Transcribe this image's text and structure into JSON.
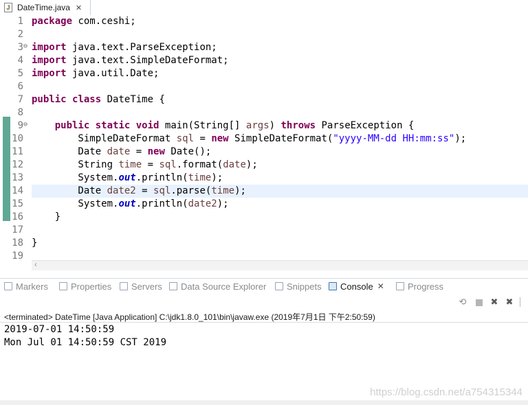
{
  "editor_tab": {
    "label": "DateTime.java",
    "file_icon_glyph": "J"
  },
  "code": [
    {
      "n": "1",
      "tokens": [
        {
          "t": "kw",
          "v": "package"
        },
        {
          "t": "plain",
          "v": " com.ceshi;"
        }
      ]
    },
    {
      "n": "2",
      "tokens": []
    },
    {
      "n": "3",
      "fold": true,
      "tokens": [
        {
          "t": "kw",
          "v": "import"
        },
        {
          "t": "plain",
          "v": " java.text.ParseException;"
        }
      ]
    },
    {
      "n": "4",
      "tokens": [
        {
          "t": "kw",
          "v": "import"
        },
        {
          "t": "plain",
          "v": " java.text.SimpleDateFormat;"
        }
      ]
    },
    {
      "n": "5",
      "tokens": [
        {
          "t": "kw",
          "v": "import"
        },
        {
          "t": "plain",
          "v": " java.util.Date;"
        }
      ]
    },
    {
      "n": "6",
      "tokens": []
    },
    {
      "n": "7",
      "tokens": [
        {
          "t": "kw",
          "v": "public"
        },
        {
          "t": "plain",
          "v": " "
        },
        {
          "t": "kw",
          "v": "class"
        },
        {
          "t": "plain",
          "v": " DateTime {"
        }
      ]
    },
    {
      "n": "8",
      "tokens": []
    },
    {
      "n": "9",
      "fold": true,
      "tokens": [
        {
          "t": "plain",
          "v": "    "
        },
        {
          "t": "kw",
          "v": "public"
        },
        {
          "t": "plain",
          "v": " "
        },
        {
          "t": "kw",
          "v": "static"
        },
        {
          "t": "plain",
          "v": " "
        },
        {
          "t": "kw",
          "v": "void"
        },
        {
          "t": "plain",
          "v": " main(String[] "
        },
        {
          "t": "local",
          "v": "args"
        },
        {
          "t": "plain",
          "v": ") "
        },
        {
          "t": "kw",
          "v": "throws"
        },
        {
          "t": "plain",
          "v": " ParseException {"
        }
      ]
    },
    {
      "n": "10",
      "tokens": [
        {
          "t": "plain",
          "v": "        SimpleDateFormat "
        },
        {
          "t": "local",
          "v": "sql"
        },
        {
          "t": "plain",
          "v": " = "
        },
        {
          "t": "kw",
          "v": "new"
        },
        {
          "t": "plain",
          "v": " SimpleDateFormat("
        },
        {
          "t": "str",
          "v": "\"yyyy-MM-dd HH:mm:ss\""
        },
        {
          "t": "plain",
          "v": ");"
        }
      ]
    },
    {
      "n": "11",
      "tokens": [
        {
          "t": "plain",
          "v": "        Date "
        },
        {
          "t": "local",
          "v": "date"
        },
        {
          "t": "plain",
          "v": " = "
        },
        {
          "t": "kw",
          "v": "new"
        },
        {
          "t": "plain",
          "v": " Date();"
        }
      ]
    },
    {
      "n": "12",
      "tokens": [
        {
          "t": "plain",
          "v": "        String "
        },
        {
          "t": "local",
          "v": "time"
        },
        {
          "t": "plain",
          "v": " = "
        },
        {
          "t": "local",
          "v": "sql"
        },
        {
          "t": "plain",
          "v": ".format("
        },
        {
          "t": "local",
          "v": "date"
        },
        {
          "t": "plain",
          "v": ");"
        }
      ]
    },
    {
      "n": "13",
      "tokens": [
        {
          "t": "plain",
          "v": "        System."
        },
        {
          "t": "field",
          "v": "out"
        },
        {
          "t": "plain",
          "v": ".println("
        },
        {
          "t": "local",
          "v": "time"
        },
        {
          "t": "plain",
          "v": ");"
        }
      ]
    },
    {
      "n": "14",
      "highlight": true,
      "tokens": [
        {
          "t": "plain",
          "v": "        Date "
        },
        {
          "t": "local",
          "v": "date2"
        },
        {
          "t": "plain",
          "v": " = "
        },
        {
          "t": "local",
          "v": "sql"
        },
        {
          "t": "plain",
          "v": ".parse("
        },
        {
          "t": "local",
          "v": "time"
        },
        {
          "t": "plain",
          "v": ");"
        }
      ]
    },
    {
      "n": "15",
      "tokens": [
        {
          "t": "plain",
          "v": "        System."
        },
        {
          "t": "field",
          "v": "out"
        },
        {
          "t": "plain",
          "v": ".println("
        },
        {
          "t": "local",
          "v": "date2"
        },
        {
          "t": "plain",
          "v": ");"
        }
      ]
    },
    {
      "n": "16",
      "tokens": [
        {
          "t": "plain",
          "v": "    }"
        }
      ]
    },
    {
      "n": "17",
      "tokens": []
    },
    {
      "n": "18",
      "tokens": [
        {
          "t": "plain",
          "v": "}"
        }
      ]
    },
    {
      "n": "19",
      "tokens": []
    }
  ],
  "view_tabs": [
    {
      "label": "Markers"
    },
    {
      "label": "Properties"
    },
    {
      "label": "Servers"
    },
    {
      "label": "Data Source Explorer"
    },
    {
      "label": "Snippets"
    },
    {
      "label": "Console",
      "active": true
    },
    {
      "label": "Progress"
    }
  ],
  "console": {
    "header": "<terminated> DateTime [Java Application] C:\\jdk1.8.0_101\\bin\\javaw.exe (2019年7月1日 下午2:50:59)",
    "output": [
      "2019-07-01 14:50:59",
      "Mon Jul 01 14:50:59 CST 2019"
    ]
  },
  "watermark": "https://blog.csdn.net/a754315344",
  "colors": {
    "keyword": "#7f0055",
    "string": "#2a00ff",
    "local": "#6a3e3e",
    "field": "#0000c0",
    "line_highlight": "#e8f2fe",
    "change_bar": "#5fa894"
  }
}
